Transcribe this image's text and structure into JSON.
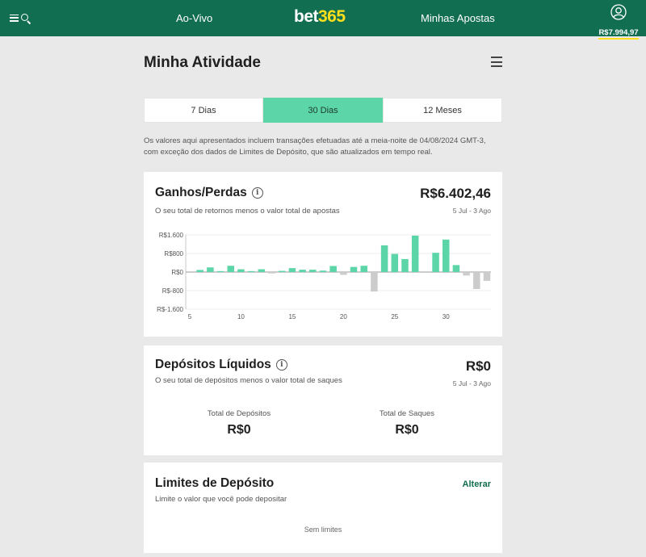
{
  "header": {
    "nav_left": "Ao-Vivo",
    "logo_part1": "bet",
    "logo_part2": "365",
    "nav_right": "Minhas Apostas",
    "balance": "R$7.994,97"
  },
  "page": {
    "title": "Minha Atividade",
    "tabs": [
      "7 Dias",
      "30 Dias",
      "12 Meses"
    ],
    "active_tab": "30 Dias",
    "disclaimer": "Os valores aqui apresentados incluem transações efetuadas até a meia-noite de 04/08/2024 GMT-3, com exceção dos dados de Limites de Depósito, que são atualizados em tempo real."
  },
  "ganhos": {
    "title": "Ganhos/Perdas",
    "subtitle": "O seu total de retornos menos o valor total de apostas",
    "amount": "R$6.402,46",
    "range": "5 Jul - 3 Ago"
  },
  "chart_data": {
    "type": "bar",
    "x": [
      5,
      6,
      7,
      8,
      9,
      10,
      11,
      12,
      13,
      14,
      15,
      16,
      17,
      18,
      19,
      20,
      21,
      22,
      23,
      24,
      25,
      26,
      27,
      28,
      29,
      30,
      31,
      32,
      33,
      34
    ],
    "values": [
      0,
      90,
      200,
      40,
      270,
      120,
      40,
      120,
      -60,
      50,
      170,
      100,
      100,
      60,
      260,
      -120,
      220,
      270,
      -840,
      1150,
      780,
      560,
      1570,
      0,
      830,
      1400,
      300,
      -150,
      -730,
      -380
    ],
    "yticks": [
      "R$1.600",
      "R$800",
      "R$0",
      "R$-800",
      "R$-1.600"
    ],
    "ylim": [
      -1600,
      1600
    ],
    "xticks": [
      "5",
      "10",
      "15",
      "20",
      "25",
      "30"
    ],
    "colors": {
      "positive": "#5cd5a8",
      "negative": "#cccccc"
    }
  },
  "depositos": {
    "title": "Depósitos Líquidos",
    "subtitle": "O seu total de depósitos menos o valor total de saques",
    "amount": "R$0",
    "range": "5 Jul - 3 Ago",
    "total_depositos_label": "Total de Depósitos",
    "total_depositos_value": "R$0",
    "total_saques_label": "Total de Saques",
    "total_saques_value": "R$0"
  },
  "limites": {
    "title": "Limites de Depósito",
    "subtitle": "Limite o valor que você pode depositar",
    "action": "Alterar",
    "status": "Sem limites"
  },
  "colors": {
    "header_bg": "#126e51",
    "accent": "#5cd5a8",
    "logo_accent": "#ffdf1b"
  }
}
